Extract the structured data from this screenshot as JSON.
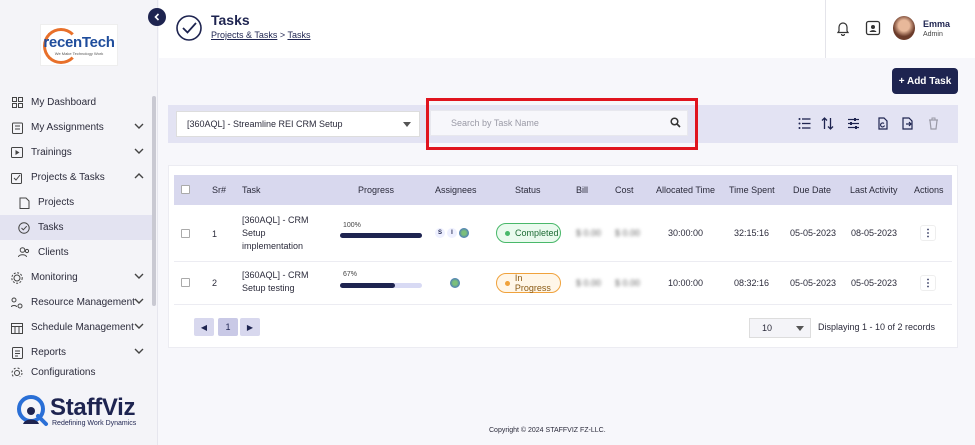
{
  "sidebar": {
    "logo": {
      "text_main": "recenTech",
      "tagline": "We Make Technology Work"
    },
    "items": [
      {
        "label": "My Dashboard",
        "icon": "dashboard-icon"
      },
      {
        "label": "My Assignments",
        "icon": "assignments-icon"
      },
      {
        "label": "Trainings",
        "icon": "trainings-icon"
      },
      {
        "label": "Projects & Tasks",
        "icon": "projects-tasks-icon"
      },
      {
        "label": "Projects",
        "icon": "projects-icon"
      },
      {
        "label": "Tasks",
        "icon": "tasks-icon"
      },
      {
        "label": "Clients",
        "icon": "clients-icon"
      },
      {
        "label": "Monitoring",
        "icon": "monitoring-icon"
      },
      {
        "label": "Resource Management",
        "icon": "resource-icon"
      },
      {
        "label": "Schedule Management",
        "icon": "schedule-icon"
      },
      {
        "label": "Reports",
        "icon": "reports-icon"
      },
      {
        "label": "Configurations",
        "icon": "config-icon"
      }
    ],
    "brand": {
      "name": "StaffViz",
      "tagline": "Redefining Work Dynamics"
    }
  },
  "header": {
    "title": "Tasks",
    "breadcrumb": [
      "Projects & Tasks",
      "Tasks"
    ],
    "user": {
      "name": "Emma",
      "role": "Admin"
    }
  },
  "toolbar": {
    "add_task_label": "+ Add Task",
    "project_selected": "[360AQL] - Streamline REI CRM Setup",
    "search_placeholder": "Search by Task Name"
  },
  "table": {
    "columns": [
      "Sr#",
      "Task",
      "Progress",
      "Assignees",
      "Status",
      "Bill",
      "Cost",
      "Allocated Time",
      "Time Spent",
      "Due Date",
      "Last Activity",
      "Actions"
    ],
    "rows": [
      {
        "sr": "1",
        "task": "[360AQL] - CRM Setup implementation",
        "progress_label": "100%",
        "progress": 1.0,
        "assignees": [
          "S",
          "I"
        ],
        "status": "Completed",
        "bill": "$ 0.00",
        "cost": "$ 0.00",
        "allocated": "30:00:00",
        "spent": "32:15:16",
        "due": "05-05-2023",
        "last_activity": "08-05-2023",
        "action": "⋮"
      },
      {
        "sr": "2",
        "task": "[360AQL] - CRM Setup testing",
        "progress_label": "67%",
        "progress": 0.67,
        "assignees": [],
        "status": "In Progress",
        "bill": "$ 0.00",
        "cost": "$ 0.00",
        "allocated": "10:00:00",
        "spent": "08:32:16",
        "due": "05-05-2023",
        "last_activity": "05-05-2023",
        "action": "⋮"
      }
    ]
  },
  "pagination": {
    "prev": "◀",
    "current": "1",
    "next": "▶",
    "page_size": "10",
    "records_text": "Displaying 1 - 10 of 2 records"
  },
  "footer": {
    "copyright": "Copyright © 2024 STAFFVIZ FZ-LLC."
  },
  "colors": {
    "primary": "#1e2450",
    "highlight": "#e0141e",
    "completed": "#49b86a",
    "in_progress": "#f0a23c"
  }
}
